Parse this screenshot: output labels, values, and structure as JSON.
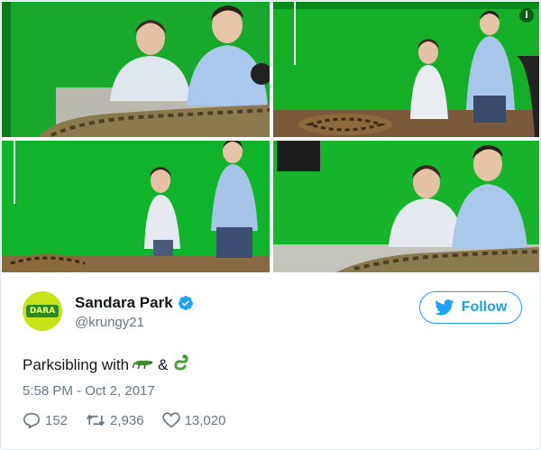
{
  "photos": [
    {
      "label": "photo-1"
    },
    {
      "label": "photo-2"
    },
    {
      "label": "photo-3"
    },
    {
      "label": "photo-4"
    }
  ],
  "photo_info_icon": "info-icon",
  "author": {
    "display_name": "Sandara Park",
    "handle": "@krungy21",
    "avatar_text": "DARA",
    "verified": true
  },
  "follow_button": {
    "label": "Follow",
    "icon": "twitter-bird-icon"
  },
  "tweet": {
    "text": "Parksibling with",
    "joiner": "&",
    "emojis": [
      "crocodile-emoji",
      "snake-emoji"
    ],
    "timestamp": "5:58 PM - Oct 2, 2017"
  },
  "actions": {
    "replies": "152",
    "retweets": "2,936",
    "likes": "13,020"
  },
  "colors": {
    "brand_blue": "#1da1f2",
    "green_screen": "#16b52a",
    "secondary_text": "#657786",
    "border": "#e1e8ed"
  }
}
